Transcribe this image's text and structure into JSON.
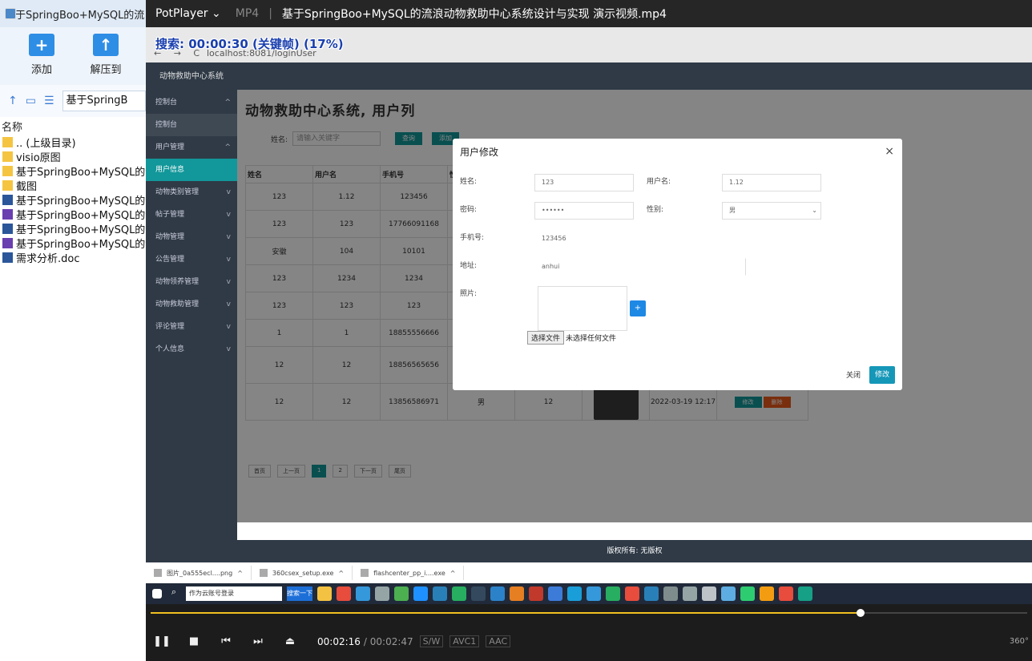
{
  "explorer": {
    "title": "基于SpringBoo+MySQL的流",
    "ribbon": {
      "add": "添加",
      "extract": "解压到"
    },
    "path": "基于SpringB",
    "column_name": "名称",
    "files": [
      {
        "name": ".. (上级目录)",
        "type": "folder"
      },
      {
        "name": "visio原图",
        "type": "folder"
      },
      {
        "name": "基于SpringBoo+MySQL的流",
        "type": "folder"
      },
      {
        "name": "截图",
        "type": "folder"
      },
      {
        "name": "基于SpringBoo+MySQL的流",
        "type": "word"
      },
      {
        "name": "基于SpringBoo+MySQL的流",
        "type": "mp4"
      },
      {
        "name": "基于SpringBoo+MySQL的流",
        "type": "word"
      },
      {
        "name": "基于SpringBoo+MySQL的流",
        "type": "mp4"
      },
      {
        "name": "需求分析.doc",
        "type": "word"
      }
    ]
  },
  "player": {
    "brand": "PotPlayer",
    "format": "MP4",
    "title": "基于SpringBoo+MySQL的流浪动物救助中心系统设计与实现 演示视频.mp4",
    "osd": "搜索: 00:00:30 (关键帧) (17%)",
    "current_time": "00:02:16",
    "total_time": "/ 00:02:47",
    "tags": [
      "S/W",
      "AVC1",
      "AAC"
    ],
    "progress": 0.81,
    "vr_label": "360°"
  },
  "browser": {
    "url": "localhost:8081/loginUser",
    "nav": "← → C"
  },
  "app": {
    "brand": "动物救助中心系统",
    "menu": [
      {
        "label": "控制台",
        "kind": "group",
        "chev": "^"
      },
      {
        "label": "控制台",
        "kind": "sub",
        "chev": ""
      },
      {
        "label": "用户管理",
        "kind": "group",
        "chev": "^"
      },
      {
        "label": "用户信息",
        "kind": "active",
        "chev": ""
      },
      {
        "label": "动物类别管理",
        "kind": "group",
        "chev": "v"
      },
      {
        "label": "帖子管理",
        "kind": "group",
        "chev": "v"
      },
      {
        "label": "动物管理",
        "kind": "group",
        "chev": "v"
      },
      {
        "label": "公告管理",
        "kind": "group",
        "chev": "v"
      },
      {
        "label": "动物领养管理",
        "kind": "group",
        "chev": "v"
      },
      {
        "label": "动物救助管理",
        "kind": "group",
        "chev": "v"
      },
      {
        "label": "评论管理",
        "kind": "group",
        "chev": "v"
      },
      {
        "label": "个人信息",
        "kind": "group",
        "chev": "v"
      }
    ],
    "page_title": "动物救助中心系统, 用户列",
    "search_label": "姓名:",
    "search_placeholder": "请输入关键字",
    "search_btn": "查询",
    "add_btn": "添加",
    "table": {
      "headers": [
        "姓名",
        "用户名",
        "手机号",
        "性",
        "",
        "",
        "",
        ""
      ],
      "rows": [
        [
          "123",
          "1.12",
          "123456",
          "",
          "",
          "",
          "",
          ""
        ],
        [
          "123",
          "123",
          "17766091168",
          "",
          "",
          "",
          "",
          ""
        ],
        [
          "安徽",
          "104",
          "10101",
          "",
          "",
          "",
          "",
          ""
        ],
        [
          "123",
          "1234",
          "1234",
          "",
          "",
          "",
          "",
          ""
        ],
        [
          "123",
          "123",
          "123",
          "",
          "",
          "",
          "",
          ""
        ],
        [
          "1",
          "1",
          "18855556666",
          "",
          "",
          "",
          "",
          ""
        ],
        [
          "12",
          "12",
          "18856565656",
          "男",
          "12",
          "",
          "2022-03-19 12:17",
          ""
        ],
        [
          "12",
          "12",
          "13856586971",
          "男",
          "12",
          "",
          "2022-03-19 12:17",
          ""
        ]
      ],
      "edit_label": "修改",
      "delete_label": "删除"
    },
    "pager": [
      "首页",
      "上一页",
      "1",
      "2",
      "下一页",
      "尾页"
    ],
    "footer": "版权所有: 无版权"
  },
  "modal": {
    "title": "用户修改",
    "close_x": "×",
    "fields": {
      "name_label": "姓名:",
      "name_value": "123",
      "username_label": "用户名:",
      "username_value": "1.12",
      "password_label": "密码:",
      "password_value": "••••••",
      "gender_label": "性别:",
      "gender_value": "男",
      "phone_label": "手机号:",
      "phone_value": "123456",
      "address_label": "地址:",
      "address_value": "anhui",
      "photo_label": "照片:"
    },
    "plus": "+",
    "choose_file": "选择文件",
    "no_file": "未选择任何文件",
    "close_btn": "关闭",
    "save_btn": "修改"
  },
  "downloads": [
    {
      "name": "图片_0a555ecl....png"
    },
    {
      "name": "360csex_setup.exe"
    },
    {
      "name": "flashcenter_pp_i....exe"
    }
  ],
  "taskbar": {
    "search": "作为云账号登录",
    "search_btn": "搜索一下"
  }
}
